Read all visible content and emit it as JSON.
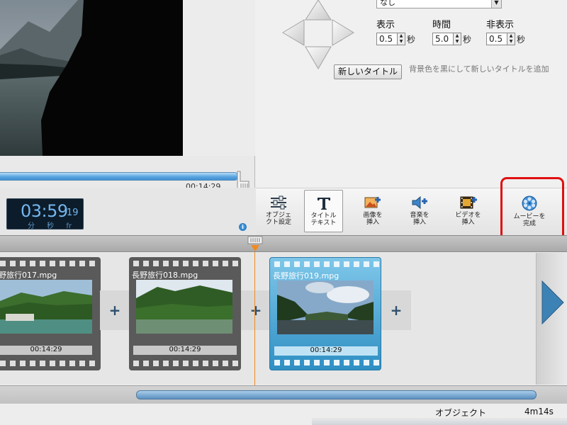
{
  "preview": {
    "elapsed": "00:14:29"
  },
  "time_display": {
    "main": "03:59",
    "frames": "19",
    "units": "分 秒 fr"
  },
  "title_controls": {
    "style_value": "なし",
    "timing": [
      {
        "label": "表示",
        "value": "0.5",
        "unit": "秒"
      },
      {
        "label": "時間",
        "value": "5.0",
        "unit": "秒"
      },
      {
        "label": "非表示",
        "value": "0.5",
        "unit": "秒"
      }
    ],
    "new_title_button": "新しいタイトル",
    "new_title_hint": "背景色を黒にして新しいタイトルを追加"
  },
  "toolbar": {
    "items": [
      {
        "label1": "オブジェ",
        "label2": "クト設定",
        "icon": "sliders-icon"
      },
      {
        "label1": "タイトル",
        "label2": "テキスト",
        "icon": "title-text-icon"
      },
      {
        "label1": "画像を",
        "label2": "挿入",
        "icon": "insert-image-icon"
      },
      {
        "label1": "音楽を",
        "label2": "挿入",
        "icon": "insert-music-icon"
      },
      {
        "label1": "ビデオを",
        "label2": "挿入",
        "icon": "insert-video-icon"
      },
      {
        "label1": "ムービーを",
        "label2": "完成",
        "icon": "film-reel-icon"
      }
    ]
  },
  "timeline": {
    "clips": [
      {
        "name": "野旅行017.mpg",
        "duration": "00:14:29",
        "selected": false
      },
      {
        "name": "長野旅行018.mpg",
        "duration": "00:14:29",
        "selected": false
      },
      {
        "name": "長野旅行019.mpg",
        "duration": "00:14:29",
        "selected": true
      }
    ],
    "add_symbol": "+"
  },
  "status": {
    "label": "オブジェクト",
    "total_time": "4m14s"
  },
  "colors": {
    "accent_blue": "#3f8fd1",
    "selected_clip": "#3a9ccc",
    "playhead": "#f08a20",
    "highlight": "#e01010",
    "time_text": "#74b6ef"
  }
}
